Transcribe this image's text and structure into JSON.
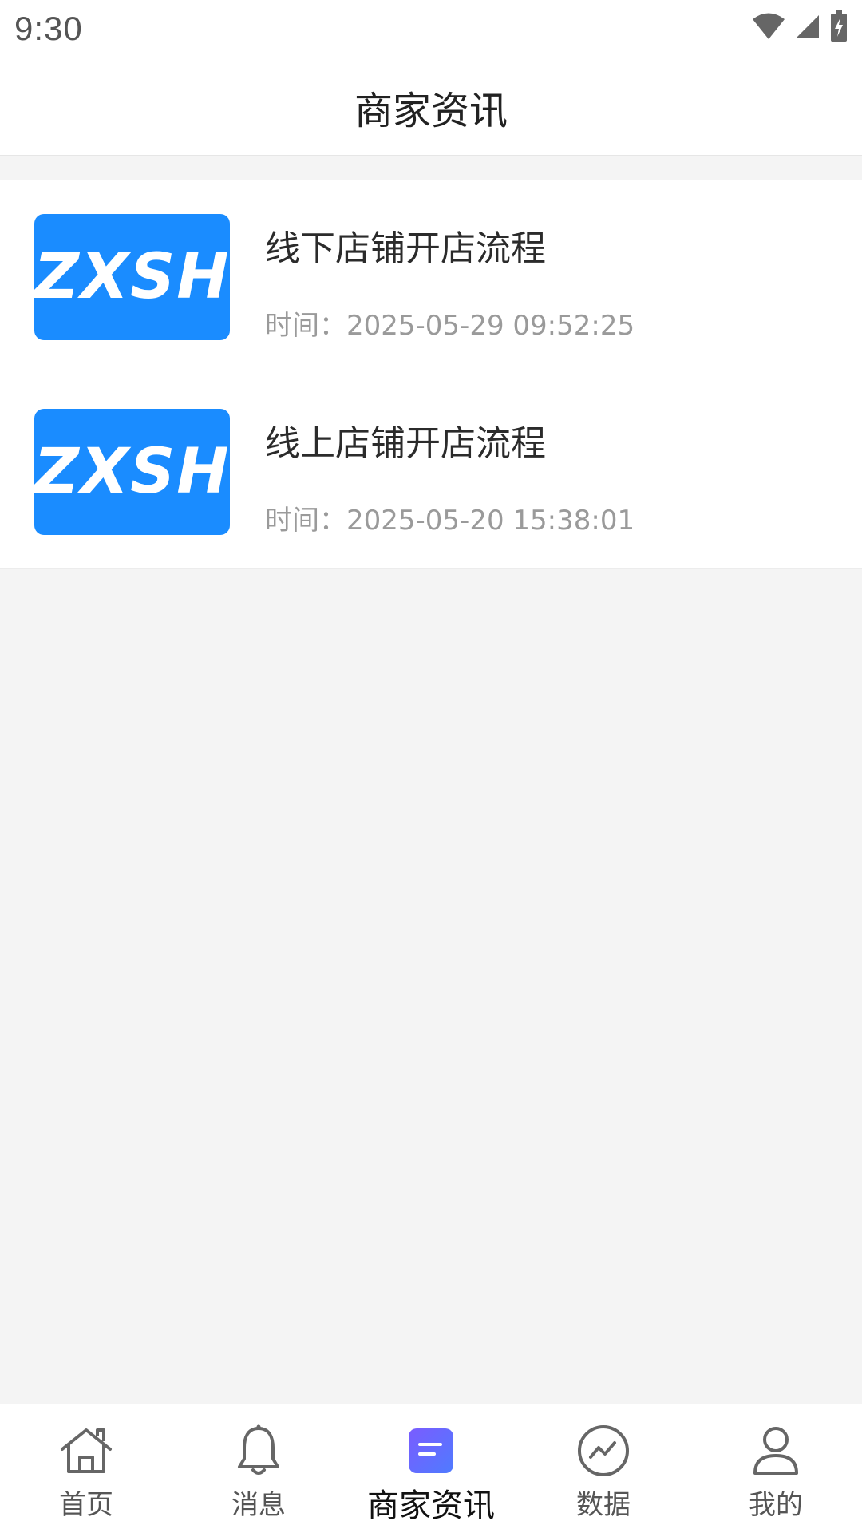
{
  "status_bar": {
    "time": "9:30",
    "icons": [
      "wifi-icon",
      "cellular-signal-icon",
      "battery-charging-icon"
    ]
  },
  "header": {
    "title": "商家资讯"
  },
  "news": {
    "items": [
      {
        "thumb_text": "ZXSH",
        "title": "线下店铺开店流程",
        "time": "时间：2025-05-29 09:52:25"
      },
      {
        "thumb_text": "ZXSH",
        "title": "线上店铺开店流程",
        "time": "时间：2025-05-20 15:38:01"
      }
    ]
  },
  "nav": {
    "items": [
      {
        "label": "首页",
        "icon": "home-icon"
      },
      {
        "label": "消息",
        "icon": "bell-icon"
      },
      {
        "label": "商家资讯",
        "icon": "news-icon",
        "active": true
      },
      {
        "label": "数据",
        "icon": "chart-icon"
      },
      {
        "label": "我的",
        "icon": "user-icon"
      }
    ]
  },
  "colors": {
    "accent": "#1a8cff",
    "active_nav_gradient_start": "#6a5cff",
    "active_nav_gradient_end": "#4f7bff",
    "background": "#f4f4f4"
  }
}
